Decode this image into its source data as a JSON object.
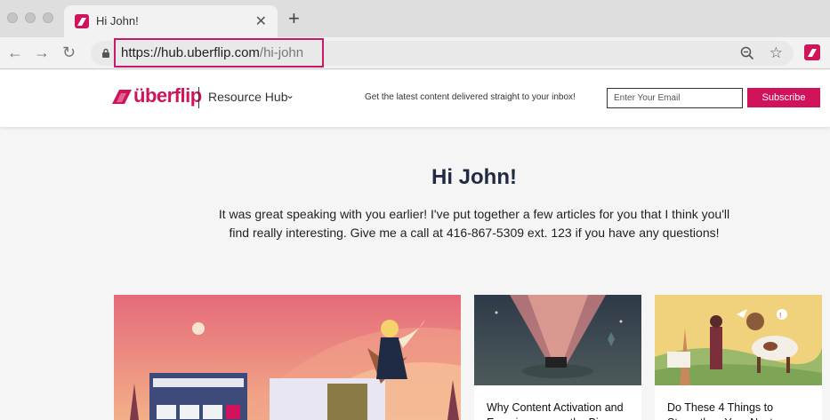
{
  "browser": {
    "tab_title": "Hi John!",
    "tab_close": "✕",
    "new_tab": "+",
    "url_host": "https://hub.uberflip.com",
    "url_path": "/hi-john",
    "back": "←",
    "forward": "→",
    "reload": "↻",
    "star": "☆"
  },
  "header": {
    "logo_text": "überflip",
    "hub_label": "Resource Hub",
    "hub_chevron": "⌄",
    "tagline": "Get the latest content delivered straight to your inbox!",
    "email_placeholder": "Enter Your Email",
    "subscribe_label": "Subscribe"
  },
  "main": {
    "greeting": "Hi John!",
    "intro": "It was great speaking with you earlier! I've put together a few articles for you that I think you'll find really interesting. Give me a call at 416-867-5309 ext. 123 if you have any questions!"
  },
  "cards": [
    {
      "title": ""
    },
    {
      "title": "Why Content Activation and Experiences are the Big"
    },
    {
      "title": "Do These 4 Things to Strengthen Your Next"
    }
  ],
  "colors": {
    "brand": "#d1135c",
    "heading": "#1f2a44"
  }
}
